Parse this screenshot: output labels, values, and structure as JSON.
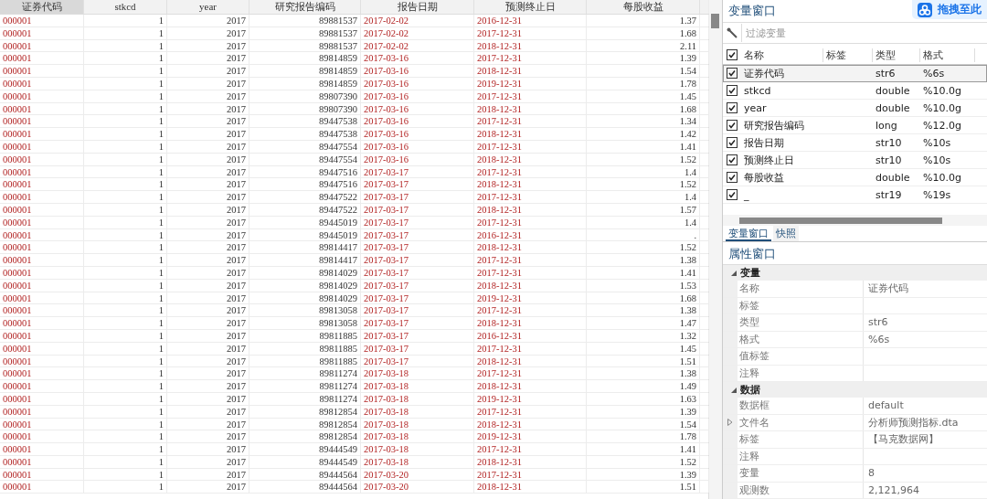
{
  "table": {
    "columns": [
      {
        "label": "证券代码",
        "kind": "string",
        "selected": true
      },
      {
        "label": "stkcd",
        "kind": "numeric",
        "selected": false
      },
      {
        "label": "year",
        "kind": "numeric",
        "selected": false
      },
      {
        "label": "研究报告编码",
        "kind": "numeric",
        "selected": false
      },
      {
        "label": "报告日期",
        "kind": "string",
        "selected": false
      },
      {
        "label": "预测终止日",
        "kind": "string",
        "selected": false
      },
      {
        "label": "每股收益",
        "kind": "numeric",
        "selected": false
      }
    ],
    "rows": [
      [
        "000001",
        "1",
        "2017",
        "89881537",
        "2017-02-02",
        "2016-12-31",
        "1.37"
      ],
      [
        "000001",
        "1",
        "2017",
        "89881537",
        "2017-02-02",
        "2017-12-31",
        "1.68"
      ],
      [
        "000001",
        "1",
        "2017",
        "89881537",
        "2017-02-02",
        "2018-12-31",
        "2.11"
      ],
      [
        "000001",
        "1",
        "2017",
        "89814859",
        "2017-03-16",
        "2017-12-31",
        "1.39"
      ],
      [
        "000001",
        "1",
        "2017",
        "89814859",
        "2017-03-16",
        "2018-12-31",
        "1.54"
      ],
      [
        "000001",
        "1",
        "2017",
        "89814859",
        "2017-03-16",
        "2019-12-31",
        "1.78"
      ],
      [
        "000001",
        "1",
        "2017",
        "89807390",
        "2017-03-16",
        "2017-12-31",
        "1.45"
      ],
      [
        "000001",
        "1",
        "2017",
        "89807390",
        "2017-03-16",
        "2018-12-31",
        "1.68"
      ],
      [
        "000001",
        "1",
        "2017",
        "89447538",
        "2017-03-16",
        "2017-12-31",
        "1.34"
      ],
      [
        "000001",
        "1",
        "2017",
        "89447538",
        "2017-03-16",
        "2018-12-31",
        "1.42"
      ],
      [
        "000001",
        "1",
        "2017",
        "89447554",
        "2017-03-16",
        "2017-12-31",
        "1.41"
      ],
      [
        "000001",
        "1",
        "2017",
        "89447554",
        "2017-03-16",
        "2018-12-31",
        "1.52"
      ],
      [
        "000001",
        "1",
        "2017",
        "89447516",
        "2017-03-17",
        "2017-12-31",
        "1.4"
      ],
      [
        "000001",
        "1",
        "2017",
        "89447516",
        "2017-03-17",
        "2018-12-31",
        "1.52"
      ],
      [
        "000001",
        "1",
        "2017",
        "89447522",
        "2017-03-17",
        "2017-12-31",
        "1.4"
      ],
      [
        "000001",
        "1",
        "2017",
        "89447522",
        "2017-03-17",
        "2018-12-31",
        "1.57"
      ],
      [
        "000001",
        "1",
        "2017",
        "89445019",
        "2017-03-17",
        "2017-12-31",
        "1.4"
      ],
      [
        "000001",
        "1",
        "2017",
        "89445019",
        "2017-03-17",
        "2016-12-31",
        "."
      ],
      [
        "000001",
        "1",
        "2017",
        "89814417",
        "2017-03-17",
        "2018-12-31",
        "1.52"
      ],
      [
        "000001",
        "1",
        "2017",
        "89814417",
        "2017-03-17",
        "2017-12-31",
        "1.38"
      ],
      [
        "000001",
        "1",
        "2017",
        "89814029",
        "2017-03-17",
        "2017-12-31",
        "1.41"
      ],
      [
        "000001",
        "1",
        "2017",
        "89814029",
        "2017-03-17",
        "2018-12-31",
        "1.53"
      ],
      [
        "000001",
        "1",
        "2017",
        "89814029",
        "2017-03-17",
        "2019-12-31",
        "1.68"
      ],
      [
        "000001",
        "1",
        "2017",
        "89813058",
        "2017-03-17",
        "2017-12-31",
        "1.38"
      ],
      [
        "000001",
        "1",
        "2017",
        "89813058",
        "2017-03-17",
        "2018-12-31",
        "1.47"
      ],
      [
        "000001",
        "1",
        "2017",
        "89811885",
        "2017-03-17",
        "2016-12-31",
        "1.32"
      ],
      [
        "000001",
        "1",
        "2017",
        "89811885",
        "2017-03-17",
        "2017-12-31",
        "1.45"
      ],
      [
        "000001",
        "1",
        "2017",
        "89811885",
        "2017-03-17",
        "2018-12-31",
        "1.51"
      ],
      [
        "000001",
        "1",
        "2017",
        "89811274",
        "2017-03-18",
        "2017-12-31",
        "1.38"
      ],
      [
        "000001",
        "1",
        "2017",
        "89811274",
        "2017-03-18",
        "2018-12-31",
        "1.49"
      ],
      [
        "000001",
        "1",
        "2017",
        "89811274",
        "2017-03-18",
        "2019-12-31",
        "1.63"
      ],
      [
        "000001",
        "1",
        "2017",
        "89812854",
        "2017-03-18",
        "2017-12-31",
        "1.39"
      ],
      [
        "000001",
        "1",
        "2017",
        "89812854",
        "2017-03-18",
        "2018-12-31",
        "1.54"
      ],
      [
        "000001",
        "1",
        "2017",
        "89812854",
        "2017-03-18",
        "2019-12-31",
        "1.78"
      ],
      [
        "000001",
        "1",
        "2017",
        "89444549",
        "2017-03-18",
        "2017-12-31",
        "1.41"
      ],
      [
        "000001",
        "1",
        "2017",
        "89444549",
        "2017-03-18",
        "2018-12-31",
        "1.52"
      ],
      [
        "000001",
        "1",
        "2017",
        "89444564",
        "2017-03-20",
        "2017-12-31",
        "1.39"
      ],
      [
        "000001",
        "1",
        "2017",
        "89444564",
        "2017-03-20",
        "2018-12-31",
        "1.51"
      ]
    ]
  },
  "variables_window": {
    "title": "变量窗口",
    "upload_button": "拖拽至此",
    "filter": {
      "placeholder": "过滤变量"
    },
    "all_checked": true,
    "columns": [
      "名称",
      "标签",
      "类型",
      "格式"
    ],
    "variables": [
      {
        "name": "证券代码",
        "type": "str6",
        "format": "%6s",
        "checked": true,
        "selected": true
      },
      {
        "name": "stkcd",
        "type": "double",
        "format": "%10.0g",
        "checked": true,
        "selected": false
      },
      {
        "name": "year",
        "type": "double",
        "format": "%10.0g",
        "checked": true,
        "selected": false
      },
      {
        "name": "研究报告编码",
        "type": "long",
        "format": "%12.0g",
        "checked": true,
        "selected": false
      },
      {
        "name": "报告日期",
        "type": "str10",
        "format": "%10s",
        "checked": true,
        "selected": false
      },
      {
        "name": "预测终止日",
        "type": "str10",
        "format": "%10s",
        "checked": true,
        "selected": false
      },
      {
        "name": "每股收益",
        "type": "double",
        "format": "%10.0g",
        "checked": true,
        "selected": false
      },
      {
        "name": "_",
        "type": "str19",
        "format": "%19s",
        "checked": true,
        "selected": false
      }
    ],
    "tabs": [
      {
        "label": "变量窗口",
        "selected": true
      },
      {
        "label": "快照",
        "selected": false
      }
    ]
  },
  "properties_window": {
    "title": "属性窗口",
    "sections": [
      {
        "title": "变量",
        "expanded": true,
        "rows": [
          {
            "label": "名称",
            "value": "证券代码",
            "kind": "plain"
          },
          {
            "label": "标签",
            "kind": "plain"
          },
          {
            "label": "类型",
            "value": "str6",
            "kind": "plain"
          },
          {
            "label": "格式",
            "value": "%6s",
            "kind": "plain"
          },
          {
            "label": "值标签",
            "kind": "plain"
          },
          {
            "label": "注释",
            "kind": "plain"
          }
        ]
      },
      {
        "title": "数据",
        "expanded": true,
        "rows": [
          {
            "label": "数据框",
            "value": "default",
            "kind": "plain"
          },
          {
            "label": "文件名",
            "value": "分析师预测指标.dta",
            "kind": "expandable"
          },
          {
            "label": "标签",
            "value": "【马克数据网】",
            "kind": "plain"
          },
          {
            "label": "注释",
            "kind": "plain"
          },
          {
            "label": "变量",
            "value": "8",
            "kind": "plain"
          },
          {
            "label": "观测数",
            "value": "2,121,964",
            "kind": "plain"
          }
        ]
      }
    ]
  }
}
